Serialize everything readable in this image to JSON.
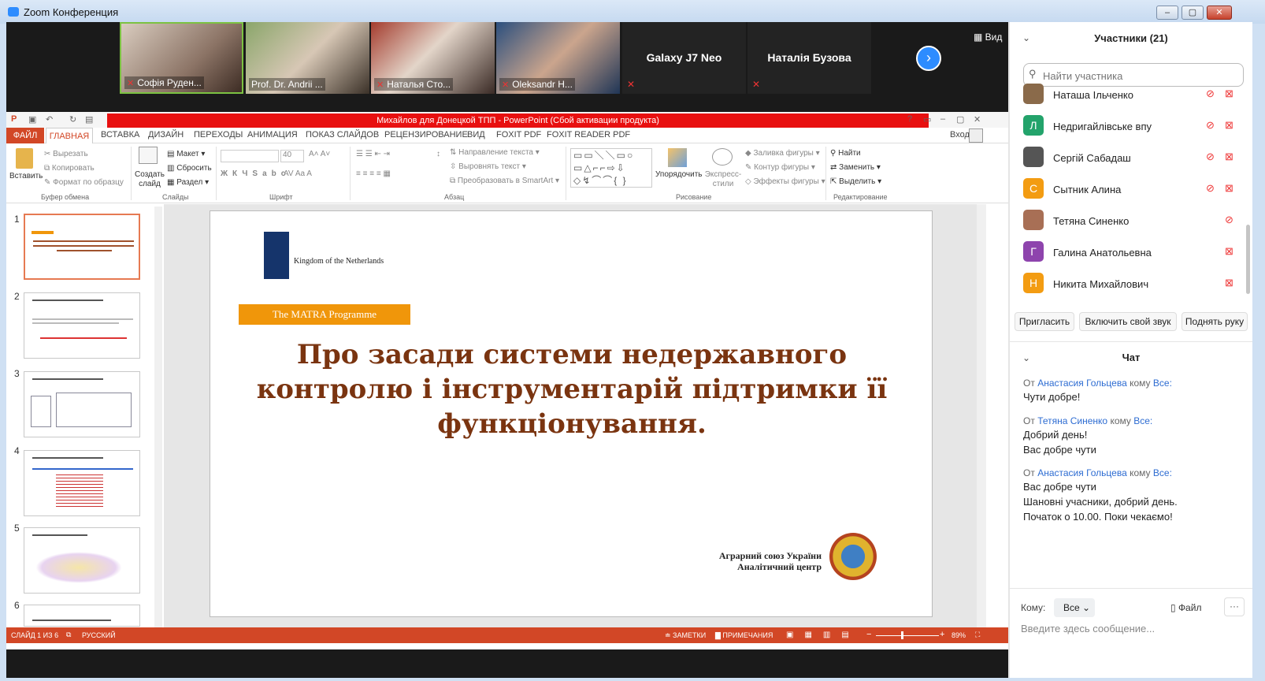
{
  "window": {
    "title": "Zoom Конференция"
  },
  "video": {
    "participants": [
      {
        "name": "Софія Руден...",
        "muted": true
      },
      {
        "name": "Prof. Dr. Andrii ...",
        "muted": false
      },
      {
        "name": "Наталья Сто...",
        "muted": true
      },
      {
        "name": "Oleksandr H...",
        "muted": true
      }
    ],
    "name_tiles": [
      "Galaxy J7 Neo",
      "Наталія Бузова"
    ],
    "view_label": "Вид"
  },
  "ppt": {
    "title": "Михайлов для Донецкой ТПП - PowerPoint (Сбой активации продукта)",
    "signin": "Вход",
    "tabs": [
      "ФАЙЛ",
      "ГЛАВНАЯ",
      "ВСТАВКА",
      "ДИЗАЙН",
      "ПЕРЕХОДЫ",
      "АНИМАЦИЯ",
      "ПОКАЗ СЛАЙДОВ",
      "РЕЦЕНЗИРОВАНИЕ",
      "ВИД",
      "FOXIT PDF",
      "FOXIT READER PDF"
    ],
    "ribbon": {
      "paste": "Вставить",
      "cut": "Вырезать",
      "copy": "Копировать",
      "format": "Формат по образцу",
      "new_slide": "Создать слайд",
      "layout": "Макет",
      "reset": "Сбросить",
      "section": "Раздел",
      "font_size": "40",
      "text_dir": "Направление текста",
      "align_text": "Выровнять текст",
      "smartart": "Преобразовать в SmartArt",
      "arrange": "Упорядочить",
      "quick_styles": "Экспресс-стили",
      "fill": "Заливка фигуры",
      "outline": "Контур фигуры",
      "effects": "Эффекты фигуры",
      "find": "Найти",
      "replace": "Заменить",
      "select": "Выделить",
      "groups": [
        "Буфер обмена",
        "Слайды",
        "Шрифт",
        "Абзац",
        "Рисование",
        "Редактирование"
      ]
    },
    "thumb_numbers": [
      "1",
      "2",
      "3",
      "4",
      "5",
      "6"
    ],
    "slide": {
      "kingdom": "Kingdom of the Netherlands",
      "programme": "The MATRA Programme",
      "title": "Про засади системи недержавного контролю і інструментарій підтримки її функціонування.",
      "union_line1": "Аграрний союз України",
      "union_line2": "Аналітичний центр"
    },
    "status": {
      "slide": "СЛАЙД 1 ИЗ 6",
      "lang": "РУССКИЙ",
      "notes": "ЗАМЕТКИ",
      "comments": "ПРИМЕЧАНИЯ",
      "zoom": "89%"
    }
  },
  "panel": {
    "title": "Участники (21)",
    "search_placeholder": "Найти участника",
    "participants": [
      {
        "name": "Наташа Ільченко",
        "initial": "",
        "color": "#8a6a4a"
      },
      {
        "name": "Недригайлівське впу",
        "initial": "Л",
        "color": "#23a36b"
      },
      {
        "name": "Сергій Сабадаш",
        "initial": "",
        "color": "#555"
      },
      {
        "name": "Сытник Алина",
        "initial": "С",
        "color": "#f39c12"
      },
      {
        "name": "Тетяна Синенко",
        "initial": "",
        "color": "#a86f55"
      },
      {
        "name": "Галина Анатольевна",
        "initial": "Г",
        "color": "#8e44ad"
      },
      {
        "name": "Никита Михайлович",
        "initial": "Н",
        "color": "#f39c12"
      }
    ],
    "buttons": {
      "invite": "Пригласить",
      "unmute": "Включить свой звук",
      "raise": "Поднять руку"
    },
    "chat_title": "Чат",
    "chat": [
      {
        "from_label": "От",
        "from": "Анастасия Гольцева",
        "to_label": "кому",
        "to": "Все:",
        "lines": [
          "Чути добре!"
        ]
      },
      {
        "from_label": "От",
        "from": "Тетяна Синенко",
        "to_label": "кому",
        "to": "Все:",
        "lines": [
          "Добрий день!",
          "Вас добре чути"
        ]
      },
      {
        "from_label": "От",
        "from": "Анастасия Гольцева",
        "to_label": "кому",
        "to": "Все:",
        "lines": [
          "Вас добре чути",
          "Шановні учасники, добрий день.",
          "Початок о 10.00. Поки чекаємо!"
        ]
      }
    ],
    "to_label": "Кому:",
    "to_value": "Все",
    "file_label": "Файл",
    "input_placeholder": "Введите здесь сообщение..."
  }
}
